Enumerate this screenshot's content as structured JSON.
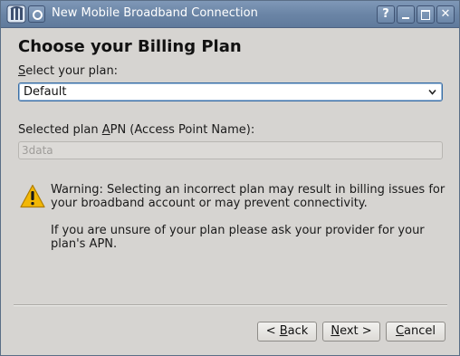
{
  "window": {
    "title": "New Mobile Broadband Connection",
    "buttons": {
      "help": "?",
      "close": "✕"
    }
  },
  "page": {
    "title": "Choose your Billing Plan"
  },
  "plan": {
    "label_mnemonic": "S",
    "label_rest": "elect your plan:",
    "selected": "Default"
  },
  "apn": {
    "label_before": "Selected plan ",
    "label_mnemonic": "A",
    "label_after": "PN (Access Point Name):",
    "value": "3data"
  },
  "warning": {
    "icon": "warning-triangle-icon",
    "line1": "Warning: Selecting an incorrect plan may result in billing issues for your broadband account or may prevent connectivity.",
    "line2": "If you are unsure of your plan please ask your provider for your plan's APN."
  },
  "buttons": {
    "back_prefix": "< ",
    "back_mnemonic": "B",
    "back_rest": "ack",
    "next_mnemonic": "N",
    "next_rest": "ext >",
    "cancel_mnemonic": "C",
    "cancel_rest": "ancel"
  },
  "colors": {
    "titlebar": "#6b85a6",
    "background": "#d6d4d1",
    "focus": "#3a6ea5",
    "warning": "#f2b705"
  }
}
